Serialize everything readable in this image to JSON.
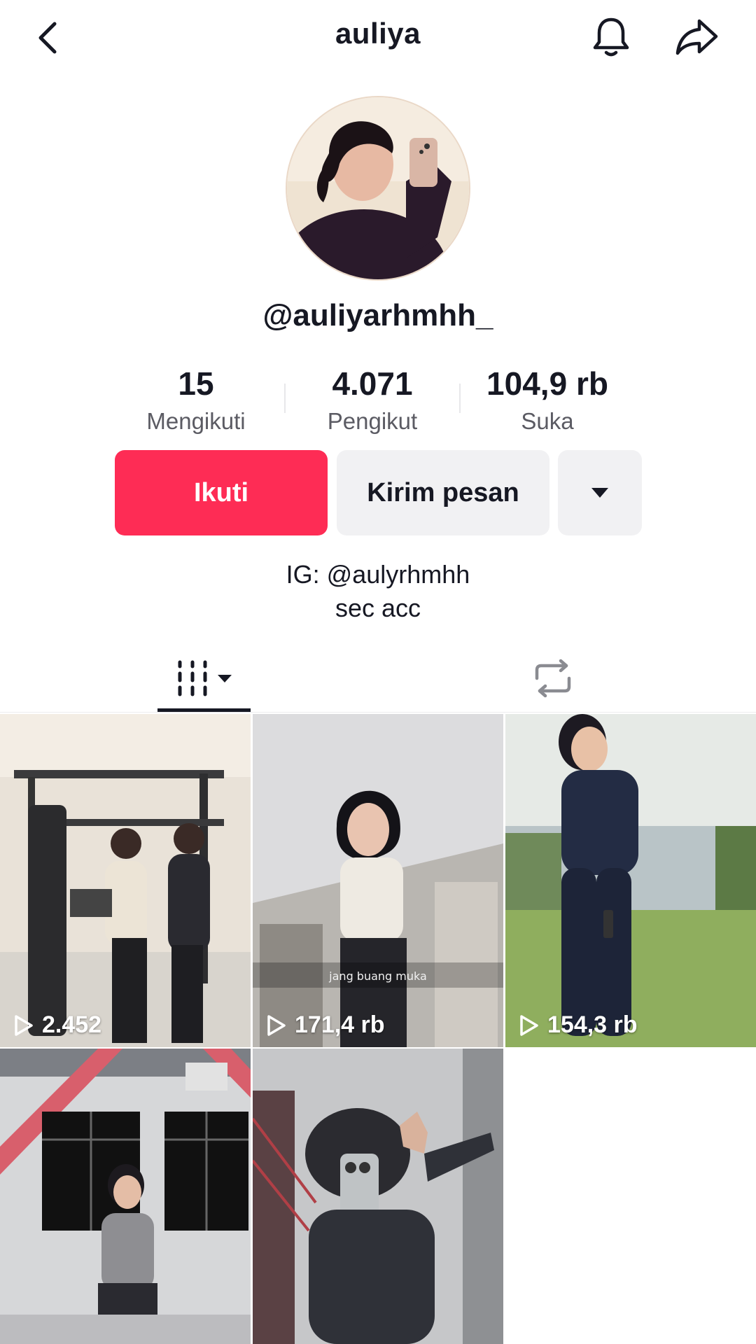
{
  "header": {
    "title": "auliya"
  },
  "profile": {
    "handle": "@auliyarhmhh_",
    "bio_line1": "IG: @aulyrhmhh",
    "bio_line2": "sec acc"
  },
  "stats": [
    {
      "value": "15",
      "label": "Mengikuti"
    },
    {
      "value": "4.071",
      "label": "Pengikut"
    },
    {
      "value": "104,9 rb",
      "label": "Suka"
    }
  ],
  "actions": {
    "follow_label": "Ikuti",
    "message_label": "Kirim pesan"
  },
  "tabs": {
    "videos_icon": "video-grid-icon",
    "repost_icon": "repost-icon"
  },
  "videos": [
    {
      "views": "2.452",
      "overlay_text": ""
    },
    {
      "views": "171,4 rb",
      "overlay_text": "jang buang muka"
    },
    {
      "views": "154,3 rb",
      "overlay_text": ""
    },
    {
      "views": "",
      "overlay_text": ""
    },
    {
      "views": "",
      "overlay_text": ""
    }
  ],
  "colors": {
    "accent": "#fe2c55",
    "button_secondary": "#f1f1f3",
    "text_primary": "#161823",
    "text_secondary": "#5b5b63"
  }
}
